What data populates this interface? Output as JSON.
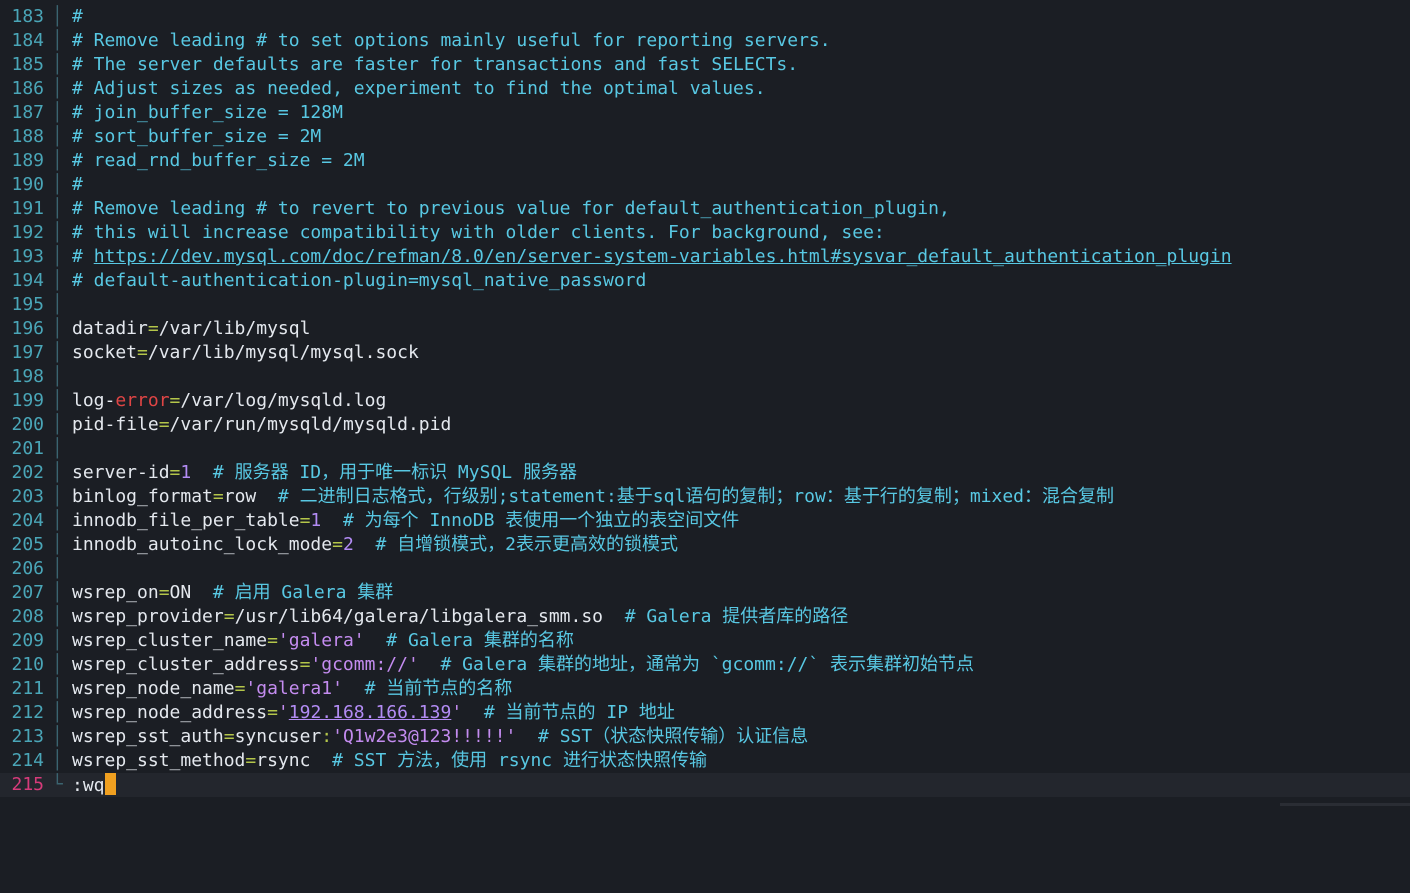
{
  "editor": {
    "lines": [
      {
        "no": "183",
        "segs": [
          [
            "c",
            "#"
          ]
        ]
      },
      {
        "no": "184",
        "segs": [
          [
            "c",
            "# Remove leading # to set options mainly useful for reporting servers."
          ]
        ]
      },
      {
        "no": "185",
        "segs": [
          [
            "c",
            "# The server defaults are faster for transactions and fast SELECTs."
          ]
        ]
      },
      {
        "no": "186",
        "segs": [
          [
            "c",
            "# Adjust sizes as needed, experiment to find the optimal values."
          ]
        ]
      },
      {
        "no": "187",
        "segs": [
          [
            "c",
            "# join_buffer_size = 128M"
          ]
        ]
      },
      {
        "no": "188",
        "segs": [
          [
            "c",
            "# sort_buffer_size = 2M"
          ]
        ]
      },
      {
        "no": "189",
        "segs": [
          [
            "c",
            "# read_rnd_buffer_size = 2M"
          ]
        ]
      },
      {
        "no": "190",
        "segs": [
          [
            "c",
            "#"
          ]
        ]
      },
      {
        "no": "191",
        "segs": [
          [
            "c",
            "# Remove leading # to revert to previous value for default_authentication_plugin,"
          ]
        ]
      },
      {
        "no": "192",
        "segs": [
          [
            "c",
            "# this will increase compatibility with older clients. For background, see:"
          ]
        ]
      },
      {
        "no": "193",
        "segs": [
          [
            "c",
            "# "
          ],
          [
            "url",
            "https://dev.mysql.com/doc/refman/8.0/en/server-system-variables.html#sysvar_default_authentication_plugin"
          ]
        ]
      },
      {
        "no": "194",
        "segs": [
          [
            "c",
            "# default-authentication-plugin=mysql_native_password"
          ]
        ]
      },
      {
        "no": "195",
        "segs": []
      },
      {
        "no": "196",
        "segs": [
          [
            "k",
            "datadir"
          ],
          [
            "op",
            "="
          ],
          [
            "k",
            "/var/lib/mysql"
          ]
        ]
      },
      {
        "no": "197",
        "segs": [
          [
            "k",
            "socket"
          ],
          [
            "op",
            "="
          ],
          [
            "k",
            "/var/lib/mysql/mysql.sock"
          ]
        ]
      },
      {
        "no": "198",
        "segs": []
      },
      {
        "no": "199",
        "segs": [
          [
            "k",
            "log-"
          ],
          [
            "red",
            "error"
          ],
          [
            "op",
            "="
          ],
          [
            "k",
            "/var/log/mysqld.log"
          ]
        ]
      },
      {
        "no": "200",
        "segs": [
          [
            "k",
            "pid-file"
          ],
          [
            "op",
            "="
          ],
          [
            "k",
            "/var/run/mysqld/mysqld.pid"
          ]
        ]
      },
      {
        "no": "201",
        "segs": []
      },
      {
        "no": "202",
        "segs": [
          [
            "k",
            "server-id"
          ],
          [
            "op",
            "="
          ],
          [
            "num",
            "1"
          ],
          [
            "c",
            "  # 服务器 ID，用于唯一标识 MySQL 服务器"
          ]
        ]
      },
      {
        "no": "203",
        "segs": [
          [
            "k",
            "binlog_format"
          ],
          [
            "op",
            "="
          ],
          [
            "k",
            "row"
          ],
          [
            "c",
            "  # 二进制日志格式，行级别;statement:基于sql语句的复制；row：基于行的复制；mixed：混合复制"
          ]
        ]
      },
      {
        "no": "204",
        "segs": [
          [
            "k",
            "innodb_file_per_table"
          ],
          [
            "op",
            "="
          ],
          [
            "num",
            "1"
          ],
          [
            "c",
            "  # 为每个 InnoDB 表使用一个独立的表空间文件"
          ]
        ]
      },
      {
        "no": "205",
        "segs": [
          [
            "k",
            "innodb_autoinc_lock_mode"
          ],
          [
            "op",
            "="
          ],
          [
            "num",
            "2"
          ],
          [
            "c",
            "  # 自增锁模式，2表示更高效的锁模式"
          ]
        ]
      },
      {
        "no": "206",
        "segs": []
      },
      {
        "no": "207",
        "segs": [
          [
            "k",
            "wsrep_on"
          ],
          [
            "op",
            "="
          ],
          [
            "k",
            "ON"
          ],
          [
            "c",
            "  # 启用 Galera 集群"
          ]
        ]
      },
      {
        "no": "208",
        "segs": [
          [
            "k",
            "wsrep_provider"
          ],
          [
            "op",
            "="
          ],
          [
            "k",
            "/usr/lib64/galera/libgalera_smm.so"
          ],
          [
            "c",
            "  # Galera 提供者库的路径"
          ]
        ]
      },
      {
        "no": "209",
        "segs": [
          [
            "k",
            "wsrep_cluster_name"
          ],
          [
            "op",
            "="
          ],
          [
            "str",
            "'galera'"
          ],
          [
            "c",
            "  # Galera 集群的名称"
          ]
        ]
      },
      {
        "no": "210",
        "segs": [
          [
            "k",
            "wsrep_cluster_address"
          ],
          [
            "op",
            "="
          ],
          [
            "str",
            "'gcomm://'"
          ],
          [
            "c",
            "  # Galera 集群的地址，通常为 `gcomm://` 表示集群初始节点"
          ]
        ]
      },
      {
        "no": "211",
        "segs": [
          [
            "k",
            "wsrep_node_name"
          ],
          [
            "op",
            "="
          ],
          [
            "str",
            "'galera1'"
          ],
          [
            "c",
            "  # 当前节点的名称"
          ]
        ]
      },
      {
        "no": "212",
        "segs": [
          [
            "k",
            "wsrep_node_address"
          ],
          [
            "op",
            "="
          ],
          [
            "str",
            "'"
          ],
          [
            "numu",
            "192.168.166.139"
          ],
          [
            "str",
            "'"
          ],
          [
            "c",
            "  # 当前节点的 IP 地址"
          ]
        ]
      },
      {
        "no": "213",
        "segs": [
          [
            "k",
            "wsrep_sst_auth"
          ],
          [
            "op",
            "="
          ],
          [
            "k",
            "syncuser"
          ],
          [
            "op",
            ":"
          ],
          [
            "str",
            "'Q1w2e3@123!!!!!'"
          ],
          [
            "c",
            "  # SST（状态快照传输）认证信息"
          ]
        ]
      },
      {
        "no": "214",
        "segs": [
          [
            "k",
            "wsrep_sst_method"
          ],
          [
            "op",
            "="
          ],
          [
            "k",
            "rsync"
          ],
          [
            "c",
            "  # SST 方法，使用 rsync 进行状态快照传输"
          ]
        ]
      }
    ],
    "command_line": {
      "no": "215",
      "text": ":wq"
    }
  },
  "colors": {
    "background": "#1b1e24",
    "line_number": "#4aa6b8",
    "current_line_number": "#d63b7a",
    "comment": "#58c8e3",
    "operator": "#b4c64a",
    "number": "#b38cf5",
    "string": "#c48cf0",
    "keyword_error": "#e04545",
    "cursor": "#f0a020"
  }
}
